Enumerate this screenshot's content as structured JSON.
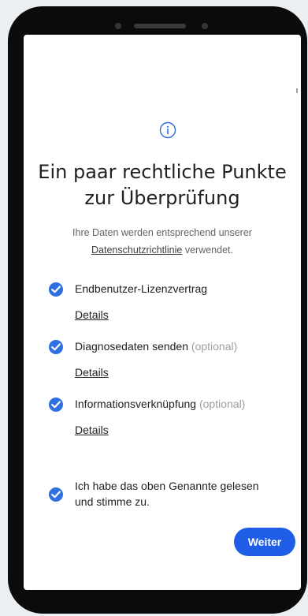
{
  "title": {
    "line1": "Ein paar rechtliche Punkte",
    "line2": "zur Überprüfung"
  },
  "subtitle": {
    "prefix": "Ihre Daten werden entsprechend unserer",
    "link": "Datenschutzrichtlinie",
    "suffix": " verwendet."
  },
  "items": [
    {
      "label": "Endbenutzer-Lizenzvertrag",
      "optional": "",
      "details": "Details",
      "checked": true
    },
    {
      "label": "Diagnosedaten senden",
      "optional": " (optional)",
      "details": "Details",
      "checked": true
    },
    {
      "label": "Informationsverknüpfung",
      "optional": " (optional)",
      "details": "Details",
      "checked": true
    }
  ],
  "agree": {
    "line1": "Ich habe das oben Genannte gelesen",
    "line2": "und stimme zu.",
    "checked": true
  },
  "next_button": "Weiter",
  "colors": {
    "accent": "#2f6fe0",
    "button": "#1f5de6"
  },
  "icons": {
    "info": "info-icon",
    "check": "check-icon"
  }
}
